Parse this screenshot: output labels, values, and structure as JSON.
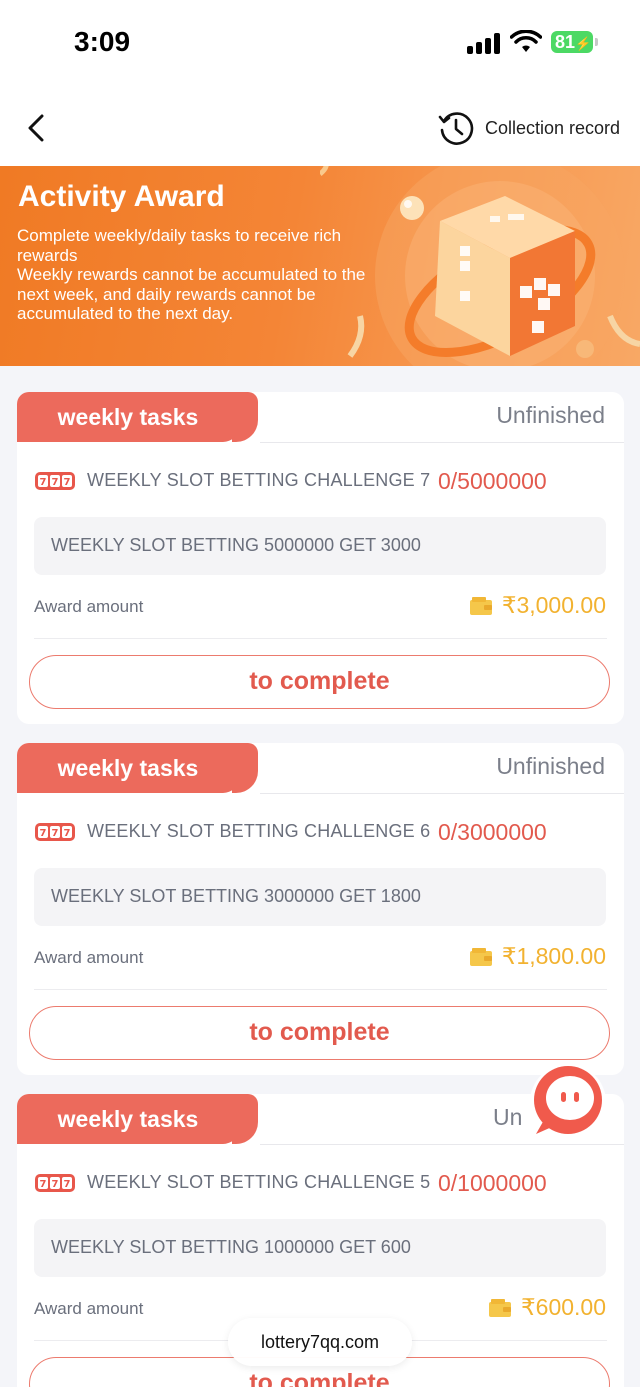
{
  "status_bar": {
    "time": "3:09",
    "battery": "81"
  },
  "nav": {
    "collection_label": "Collection record"
  },
  "banner": {
    "title": "Activity Award",
    "description": "Complete weekly/daily tasks to receive rich rewards\nWeekly rewards cannot be accumulated to the next week, and daily rewards cannot be accumulated to the next day."
  },
  "tasks": [
    {
      "tab_label": "weekly tasks",
      "status": "Unfinished",
      "name": "WEEKLY SLOT BETTING CHALLENGE 7",
      "progress": "0/5000000",
      "description": "WEEKLY SLOT BETTING 5000000 GET 3000",
      "award_label": "Award amount",
      "award_amount": "₹3,000.00",
      "button_label": "to complete"
    },
    {
      "tab_label": "weekly tasks",
      "status": "Unfinished",
      "name": "WEEKLY SLOT BETTING CHALLENGE 6",
      "progress": "0/3000000",
      "description": "WEEKLY SLOT BETTING 3000000 GET 1800",
      "award_label": "Award amount",
      "award_amount": "₹1,800.00",
      "button_label": "to complete"
    },
    {
      "tab_label": "weekly tasks",
      "status": "Un",
      "name": "WEEKLY SLOT BETTING CHALLENGE 5",
      "progress": "0/1000000",
      "description": "WEEKLY SLOT BETTING 1000000 GET 600",
      "award_label": "Award amount",
      "award_amount": "₹600.00",
      "button_label": "to complete"
    }
  ],
  "footer": {
    "domain": "lottery7qq.com"
  },
  "colors": {
    "accent": "#ec6a5c",
    "award": "#f2b230",
    "banner": "#f07a24"
  }
}
